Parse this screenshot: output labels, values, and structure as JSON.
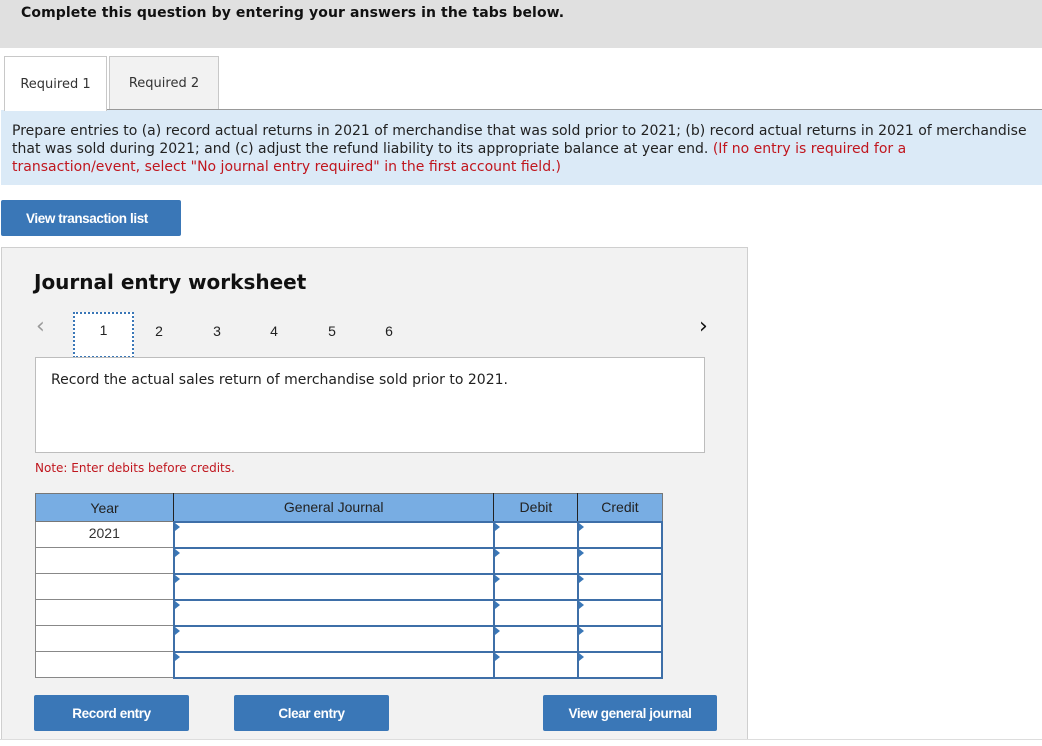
{
  "banner": {
    "text": "Complete this question by entering your answers in the tabs below."
  },
  "tabs": [
    {
      "label": "Required 1",
      "active": true
    },
    {
      "label": "Required 2",
      "active": false
    }
  ],
  "instructions": {
    "text": "Prepare entries to (a) record actual returns in 2021 of merchandise that was sold prior to 2021; (b) record actual returns in 2021 of merchandise that was sold during 2021; and (c) adjust the refund liability to its appropriate balance at year end.",
    "hint": "(If no entry is required for a transaction/event, select \"No journal entry required\" in the first account field.)"
  },
  "buttons": {
    "view_transaction_list": "View transaction list",
    "record_entry": "Record entry",
    "clear_entry": "Clear entry",
    "view_general_journal": "View general journal"
  },
  "worksheet": {
    "title": "Journal entry worksheet",
    "prev_icon": "‹",
    "next_icon": "›",
    "pages": [
      "1",
      "2",
      "3",
      "4",
      "5",
      "6"
    ],
    "active_page": "1",
    "description": "Record the actual sales return of merchandise sold prior to 2021.",
    "note": "Note: Enter debits before credits."
  },
  "journal": {
    "headers": {
      "year": "Year",
      "general_journal": "General Journal",
      "debit": "Debit",
      "credit": "Credit"
    },
    "rows": [
      {
        "year": "2021",
        "account": "",
        "debit": "",
        "credit": ""
      },
      {
        "year": "",
        "account": "",
        "debit": "",
        "credit": ""
      },
      {
        "year": "",
        "account": "",
        "debit": "",
        "credit": ""
      },
      {
        "year": "",
        "account": "",
        "debit": "",
        "credit": ""
      },
      {
        "year": "",
        "account": "",
        "debit": "",
        "credit": ""
      },
      {
        "year": "",
        "account": "",
        "debit": "",
        "credit": ""
      }
    ]
  },
  "colors": {
    "accent": "#3a77b7",
    "header_blue": "#78ade3",
    "instructions_bg": "#dbeaf7",
    "hint_red": "#c0161e"
  }
}
